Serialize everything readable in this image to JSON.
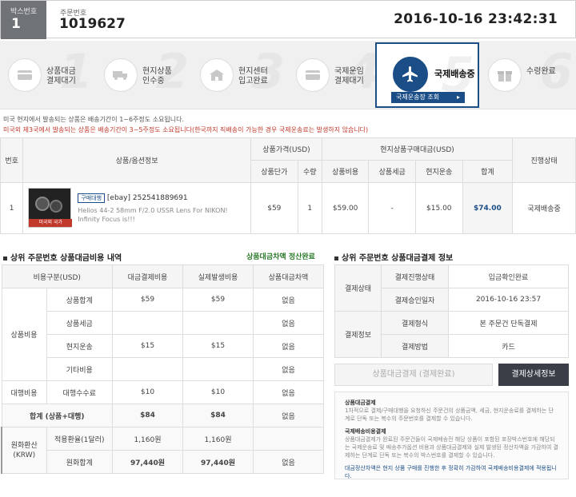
{
  "header": {
    "box_label": "박스번호",
    "box_no": "1",
    "order_label": "주문번호",
    "order_no": "1019627",
    "datetime": "2016-10-16 23:42:31"
  },
  "steps": [
    {
      "l1": "상품대금",
      "l2": "결제대기",
      "num": "1",
      "icon": "card-icon"
    },
    {
      "l1": "현지상품",
      "l2": "인수중",
      "num": "2",
      "icon": "truck-icon"
    },
    {
      "l1": "현지센터",
      "l2": "입고완료",
      "num": "3",
      "icon": "warehouse-icon"
    },
    {
      "l1": "국제운임",
      "l2": "결제대기",
      "num": "4",
      "icon": "card-icon"
    },
    {
      "l1": "국제배송중",
      "l2": "",
      "num": "5",
      "icon": "airplane-icon",
      "active": true,
      "button": "국제운송장 조회"
    },
    {
      "l1": "수령완료",
      "l2": "",
      "num": "6",
      "icon": "gift-icon"
    }
  ],
  "notes": {
    "n1": "미국 현지에서 발송되는 상품은 배송기간이 1~6주정도 소요됩니다.",
    "n2": "미국외 제3국에서 발송되는 상품은 배송기간이 3~5주정도 소요됩니다(한국까지 직배송이 가능한 경우 국제운송료는 발생하지 않습니다)"
  },
  "item_table": {
    "h": {
      "no": "번호",
      "product": "상품/옵션정보",
      "price": "상품가격(USD)",
      "unit": "상품단가",
      "qty": "수량",
      "local": "현지상품구매대금(USD)",
      "cost": "상품비용",
      "tax": "상품세금",
      "ship": "현지운송",
      "total": "합계",
      "status": "진행상태"
    },
    "row": {
      "no": "1",
      "tag": "구매대행",
      "title": "[ebay] 252541889691",
      "desc": "Helios 44-2 58mm F/2.0 USSR Lens For NIKON! Infinity Focus is!!!",
      "origin": "미국외 국가",
      "unit": "$59",
      "qty": "1",
      "cost": "$59.00",
      "tax": "-",
      "ship": "$15.00",
      "total": "$74.00",
      "status": "국제배송중"
    }
  },
  "left": {
    "title": "상위 주문번호 상품대금비용 내역",
    "badge": "상품대금차액 정산완료",
    "h": [
      "비용구분(USD)",
      "대금결제비용",
      "실제발생비용",
      "상품대금차액"
    ],
    "g1": "상품비용",
    "g2": "대행비용",
    "rows": [
      {
        "label": "상품합계",
        "a": "$59",
        "b": "$59",
        "c": "없음"
      },
      {
        "label": "상품세금",
        "a": "",
        "b": "",
        "c": "없음"
      },
      {
        "label": "현지운송",
        "a": "$15",
        "b": "$15",
        "c": "없음"
      },
      {
        "label": "기타비용",
        "a": "",
        "b": "",
        "c": "없음"
      },
      {
        "label": "대행수수료",
        "a": "$10",
        "b": "$10",
        "c": "없음"
      }
    ],
    "sum": {
      "label": "합계 (상품+대행)",
      "a": "$84",
      "b": "$84",
      "c": "없음"
    },
    "krw_group": "원화환산 (KRW)",
    "krw": [
      {
        "label": "적용환율(1달러)",
        "a": "1,160원",
        "b": "1,160원",
        "c": ""
      },
      {
        "label": "원화합계",
        "a": "97,440원",
        "b": "97,440원",
        "c": "없음"
      }
    ]
  },
  "right": {
    "title": "상위 주문번호 상품대금결제 정보",
    "g1": "결제상태",
    "g2": "결제정보",
    "rows": [
      {
        "label": "결제진행상태",
        "value": "입금확인완료"
      },
      {
        "label": "결제승인일자",
        "value": "2016-10-16 23:57"
      },
      {
        "label": "결제형식",
        "value": "본 주문건 단독결제"
      },
      {
        "label": "결제방법",
        "value": "카드"
      }
    ],
    "btn_pay": "상품대금결제 (결제완료)",
    "btn_detail": "결제상세정보",
    "info": {
      "t1": "상품대금결제",
      "p1": "1차적으로 결제/구매대행을 요청하신 주문건의 상품금액, 세금, 현지운송료를 결제하는 단계로 단독 또는 복수의 주문번호를 결제할 수 있습니다.",
      "t2": "국제배송비용결제",
      "p2": "상품대금결제가 완료된 주문건들이 국제배송전 해당 상품이 포함된 포장박스번호에 해당되는 국제운송료 및 배송추가옵션 비용과 상품대금결제와 실제 발생된 정산차액을 가감하여 결제하는 단계로 단독 또는 복수의 박스번호를 결제할 수 있습니다.",
      "p3": "대금정산차액은 현지 상품 구매를 진행한 후 정확히 가감하여 국제배송비용결제에 적용됩니다."
    }
  },
  "colors": {
    "accent": "#1b4e87",
    "green": "#2a7a2a",
    "total_blue": "#1b4e87",
    "red": "#c0392b"
  }
}
